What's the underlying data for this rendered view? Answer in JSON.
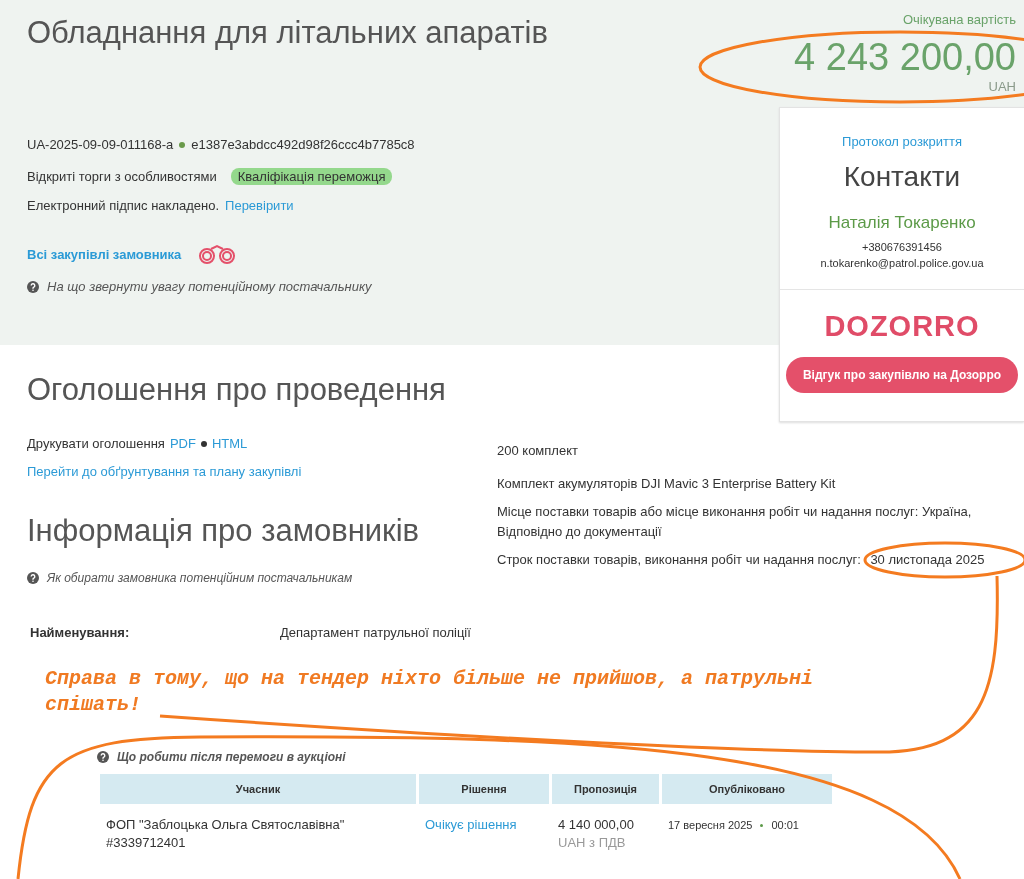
{
  "header": {
    "title": "Обладнання для літальних апаратів",
    "tender_id": "UA-2025-09-09-011168-a",
    "hash": "e1387e3abdcc492d98f26ccc4b7785c8",
    "procedure": "Відкриті торги з особливостями",
    "status_badge": "Кваліфікація переможця",
    "signature_text": "Електронний підпис накладено.",
    "signature_link": "Перевірити",
    "buyer_link": "Всі закупівлі замовника",
    "hint": "На що звернути увагу потенційному постачальнику"
  },
  "price": {
    "label": "Очікувана вартість",
    "amount": "4 243 200,00",
    "currency": "UAH"
  },
  "sidebar": {
    "protocol_link": "Протокол розкриття",
    "contacts_title": "Контакти",
    "contact_name": "Наталія Токаренко",
    "phone": "+380676391456",
    "email": "n.tokarenko@patrol.police.gov.ua",
    "logo": "DOZORRO",
    "feedback_button": "Відгук про закупівлю на Дозорро"
  },
  "announcement": {
    "title": "Оголошення про проведення",
    "print_label": "Друкувати оголошення",
    "print_links": [
      "PDF",
      "HTML"
    ],
    "plan_link": "Перейти до обґрунтування та плану закупівлі"
  },
  "item": {
    "quantity": "200 комплект",
    "description": "Комплект акумуляторів DJI Mavic 3 Enterprise Battery Kit",
    "delivery_place": "Місце поставки товарів або місце виконання робіт чи надання послуг: Україна, Відповідно до документації",
    "delivery_term_label": "Строк поставки товарів, виконання робіт чи надання послуг:",
    "delivery_term_value": "30 листопада 2025"
  },
  "customer": {
    "title": "Інформація про замовників",
    "hint": "Як обирати замовника потенційним постачальникам",
    "fields": [
      {
        "label": "Найменування:",
        "value": "Департамент патрульної поліції"
      }
    ]
  },
  "annotation": {
    "text": "Справа в тому, що на тендер ніхто більше не прийшов, а патрульні спішать!"
  },
  "award": {
    "hint": "Що робити після перемоги в аукціоні",
    "columns": [
      "Учасник",
      "Рішення",
      "Пропозиція",
      "Опубліковано"
    ],
    "rows": [
      {
        "participant": "ФОП \"Заблоцька Ольга Святославівна\"",
        "participant_id": "#3339712401",
        "decision": "Очікує рішення",
        "proposal": "4 140 000,00",
        "offer_note": "UAH з ПДВ",
        "date": "17 вересня 2025",
        "time": "00:01"
      }
    ]
  }
}
